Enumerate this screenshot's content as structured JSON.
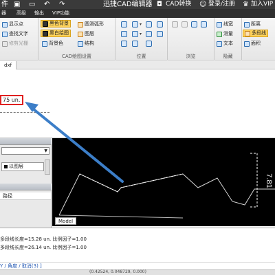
{
  "titlebar": {
    "left_label": "件",
    "title": "迅捷CAD编辑器",
    "cad_convert": "CAD转换",
    "login": "登录/注册",
    "vip": "加入VIP"
  },
  "menubar": {
    "items": [
      "器",
      "高级",
      "输出",
      "VIP功能"
    ]
  },
  "ribbon": {
    "groups": [
      {
        "label": "",
        "buttons": [
          {
            "label": "显示点",
            "icon": "point-icon"
          },
          {
            "label": "查找文字",
            "icon": "find-text-icon"
          },
          {
            "label": "修剪光栅",
            "icon": "trim-raster-icon",
            "disabled": true
          }
        ]
      },
      {
        "label": "CAD绘图设置",
        "buttons": [
          {
            "label": "黑色背景",
            "icon": "black-bg-icon",
            "selected": true
          },
          {
            "label": "圆滑弧形",
            "icon": "smooth-arc-icon"
          },
          {
            "label": "黑白绘图",
            "icon": "bw-draw-icon",
            "selected": true
          },
          {
            "label": "图层",
            "icon": "layer-icon"
          },
          {
            "label": "背景色",
            "icon": "bg-color-icon"
          },
          {
            "label": "结构",
            "icon": "structure-icon"
          }
        ]
      },
      {
        "label": "位置"
      },
      {
        "label": "浏览"
      },
      {
        "label": "隐藏",
        "buttons": [
          {
            "label": "线宽",
            "icon": "line-width-icon"
          },
          {
            "label": "测量",
            "icon": "measure-icon"
          },
          {
            "label": "文本",
            "icon": "text-icon"
          }
        ]
      },
      {
        "label": "",
        "buttons": [
          {
            "label": "距离",
            "icon": "distance-icon"
          },
          {
            "label": "多段线",
            "icon": "polyline-icon",
            "selected": true
          },
          {
            "label": "面积",
            "icon": "area-icon"
          }
        ]
      }
    ]
  },
  "doc_tab": {
    "label": "dxf"
  },
  "measurement": {
    "value_text": "75 un."
  },
  "layer_panel": {
    "layer_name": "以图层",
    "path_label": "路径"
  },
  "canvas": {
    "dimension_text": "7.81",
    "model_tab": "Model"
  },
  "command_history": [
    "多段线长度=15.28 un. 比例因子=1.00",
    "多段线长度=26.14 un. 比例因子=1.00"
  ],
  "command_input": {
    "text": "Y / 角度 / 取消(3) ]"
  },
  "status": {
    "coords": "(0.42524, 0.048729, 0.000)"
  },
  "colors": {
    "highlight_box": "#e02020",
    "arrow": "#3c7ec8",
    "selected_button": "#ffd35c",
    "canvas_bg": "#000000"
  }
}
